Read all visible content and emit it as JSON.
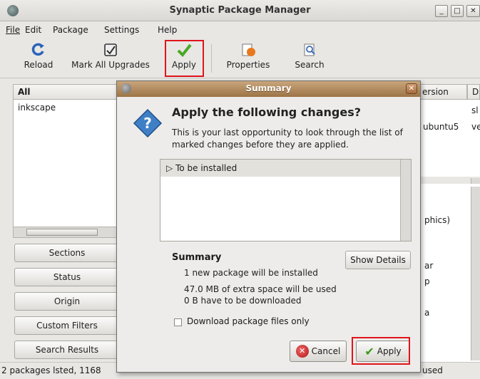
{
  "window": {
    "title": "Synaptic Package Manager",
    "min_label": "_",
    "max_label": "□",
    "close_label": "✕"
  },
  "menu": {
    "file": "File",
    "edit": "Edit",
    "package": "Package",
    "settings": "Settings",
    "help": "Help"
  },
  "toolbar": {
    "reload": "Reload",
    "mark_all_upgrades": "Mark All Upgrades",
    "apply": "Apply",
    "properties": "Properties",
    "search": "Search"
  },
  "left_pane": {
    "header": "All",
    "items": [
      "inkscape"
    ],
    "buttons": {
      "sections": "Sections",
      "status": "Status",
      "origin": "Origin",
      "custom_filters": "Custom Filters",
      "search_results": "Search Results"
    }
  },
  "package_list": {
    "col_version_partial": "ersion",
    "col_desc_partial": "D",
    "row_partial_1": "sl",
    "row_version_partial": "ubuntu5",
    "row_partial_2": "ve"
  },
  "description_partial": {
    "line1": "phics)",
    "line2": "ar",
    "line3": "p",
    "line4": "a"
  },
  "statusbar": {
    "left": "2 packages lsted, 1168",
    "right": "used"
  },
  "dialog": {
    "title": "Summary",
    "heading": "Apply the following changes?",
    "description": "This is your last opportunity to look through the list of marked changes before they are applied.",
    "changes_row": "To be installed",
    "summary_title": "Summary",
    "summary_lines": [
      "1 new package will be installed",
      "47.0 MB of extra space will be used",
      "0  B have to be downloaded"
    ],
    "show_details": "Show Details",
    "download_only": "Download package files only",
    "cancel": "Cancel",
    "apply": "Apply"
  },
  "colors": {
    "highlight": "#e0141b",
    "dialog_title": "#b08859"
  }
}
